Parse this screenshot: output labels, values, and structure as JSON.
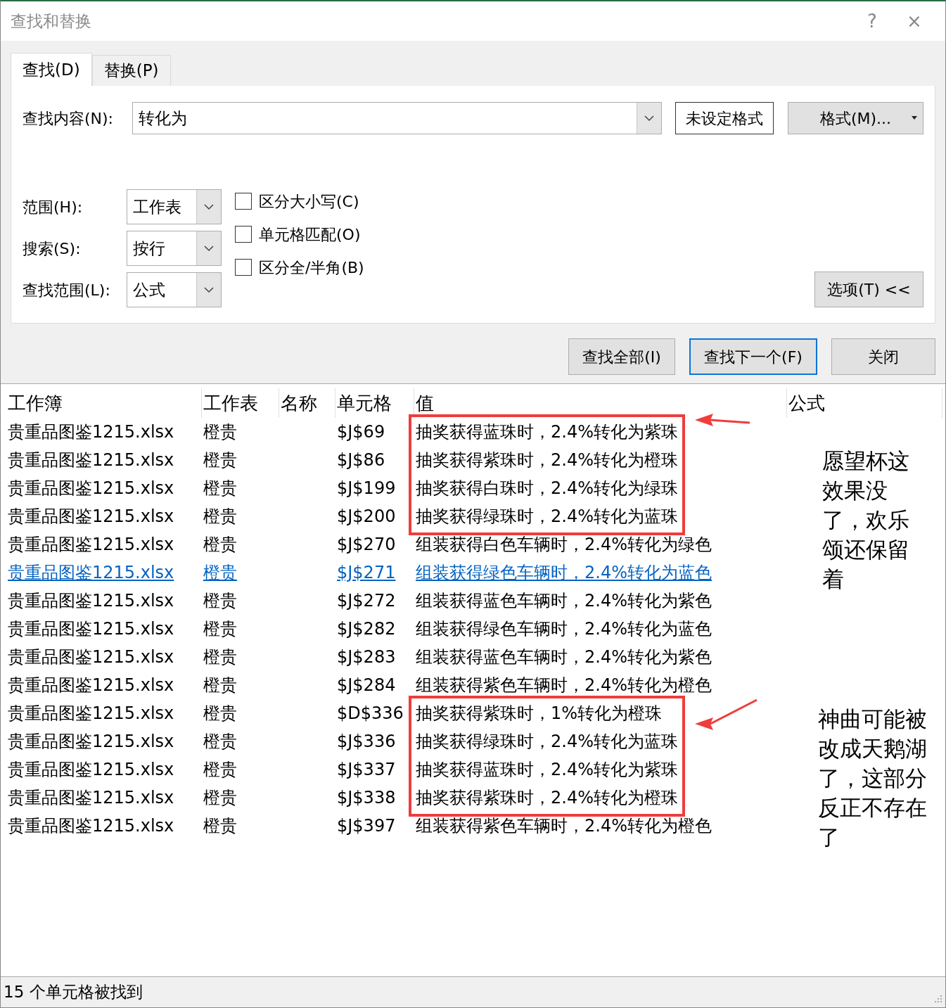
{
  "window": {
    "title": "查找和替换",
    "help": "?",
    "close": "×"
  },
  "tabs": [
    {
      "label": "查找(D)",
      "selected": true
    },
    {
      "label": "替换(P)",
      "selected": false
    }
  ],
  "find": {
    "label": "查找内容(N):",
    "value": "转化为"
  },
  "format_status": "未设定格式",
  "format_button": "格式(M)...",
  "options": [
    {
      "label": "范围(H):",
      "value": "工作表"
    },
    {
      "label": "搜索(S):",
      "value": "按行"
    },
    {
      "label": "查找范围(L):",
      "value": "公式"
    }
  ],
  "checkboxes": [
    {
      "label": "区分大小写(C)",
      "checked": false
    },
    {
      "label": "单元格匹配(O)",
      "checked": false
    },
    {
      "label": "区分全/半角(B)",
      "checked": false
    }
  ],
  "options_toggle": "选项(T) <<",
  "actions": [
    {
      "label": "查找全部(I)",
      "default": false
    },
    {
      "label": "查找下一个(F)",
      "default": true
    },
    {
      "label": "关闭",
      "default": false
    }
  ],
  "results": {
    "columns": [
      "工作簿",
      "工作表",
      "名称",
      "单元格",
      "值",
      "公式"
    ],
    "rows": [
      {
        "workbook": "贵重品图鉴1215.xlsx",
        "sheet": "橙贵",
        "cell": "$J$69",
        "value": "抽奖获得蓝珠时，2.4%转化为紫珠",
        "selected": false,
        "boxed": true
      },
      {
        "workbook": "贵重品图鉴1215.xlsx",
        "sheet": "橙贵",
        "cell": "$J$86",
        "value": "抽奖获得紫珠时，2.4%转化为橙珠",
        "selected": false,
        "boxed": true
      },
      {
        "workbook": "贵重品图鉴1215.xlsx",
        "sheet": "橙贵",
        "cell": "$J$199",
        "value": "抽奖获得白珠时，2.4%转化为绿珠",
        "selected": false,
        "boxed": true
      },
      {
        "workbook": "贵重品图鉴1215.xlsx",
        "sheet": "橙贵",
        "cell": "$J$200",
        "value": "抽奖获得绿珠时，2.4%转化为蓝珠",
        "selected": false,
        "boxed": true
      },
      {
        "workbook": "贵重品图鉴1215.xlsx",
        "sheet": "橙贵",
        "cell": "$J$270",
        "value": "组装获得白色车辆时，2.4%转化为绿色",
        "selected": false,
        "boxed": false
      },
      {
        "workbook": "贵重品图鉴1215.xlsx",
        "sheet": "橙贵",
        "cell": "$J$271",
        "value": "组装获得绿色车辆时，2.4%转化为蓝色",
        "selected": true,
        "boxed": false
      },
      {
        "workbook": "贵重品图鉴1215.xlsx",
        "sheet": "橙贵",
        "cell": "$J$272",
        "value": "组装获得蓝色车辆时，2.4%转化为紫色",
        "selected": false,
        "boxed": false
      },
      {
        "workbook": "贵重品图鉴1215.xlsx",
        "sheet": "橙贵",
        "cell": "$J$282",
        "value": "组装获得绿色车辆时，2.4%转化为蓝色",
        "selected": false,
        "boxed": false
      },
      {
        "workbook": "贵重品图鉴1215.xlsx",
        "sheet": "橙贵",
        "cell": "$J$283",
        "value": "组装获得蓝色车辆时，2.4%转化为紫色",
        "selected": false,
        "boxed": false
      },
      {
        "workbook": "贵重品图鉴1215.xlsx",
        "sheet": "橙贵",
        "cell": "$J$284",
        "value": "组装获得紫色车辆时，2.4%转化为橙色",
        "selected": false,
        "boxed": false
      },
      {
        "workbook": "贵重品图鉴1215.xlsx",
        "sheet": "橙贵",
        "cell": "$D$336",
        "value": "抽奖获得紫珠时，1%转化为橙珠",
        "selected": false,
        "boxed": true
      },
      {
        "workbook": "贵重品图鉴1215.xlsx",
        "sheet": "橙贵",
        "cell": "$J$336",
        "value": "抽奖获得绿珠时，2.4%转化为蓝珠",
        "selected": false,
        "boxed": true
      },
      {
        "workbook": "贵重品图鉴1215.xlsx",
        "sheet": "橙贵",
        "cell": "$J$337",
        "value": "抽奖获得蓝珠时，2.4%转化为紫珠",
        "selected": false,
        "boxed": true
      },
      {
        "workbook": "贵重品图鉴1215.xlsx",
        "sheet": "橙贵",
        "cell": "$J$338",
        "value": "抽奖获得紫珠时，2.4%转化为橙珠",
        "selected": false,
        "boxed": true
      },
      {
        "workbook": "贵重品图鉴1215.xlsx",
        "sheet": "橙贵",
        "cell": "$J$397",
        "value": "组装获得紫色车辆时，2.4%转化为橙色",
        "selected": false,
        "boxed": false
      }
    ]
  },
  "callouts": [
    "愿望杯这效果没了，欢乐颂还保留着",
    "神曲可能被改成天鹅湖了，这部分反正不存在了"
  ],
  "status_bar": "15 个单元格被找到"
}
